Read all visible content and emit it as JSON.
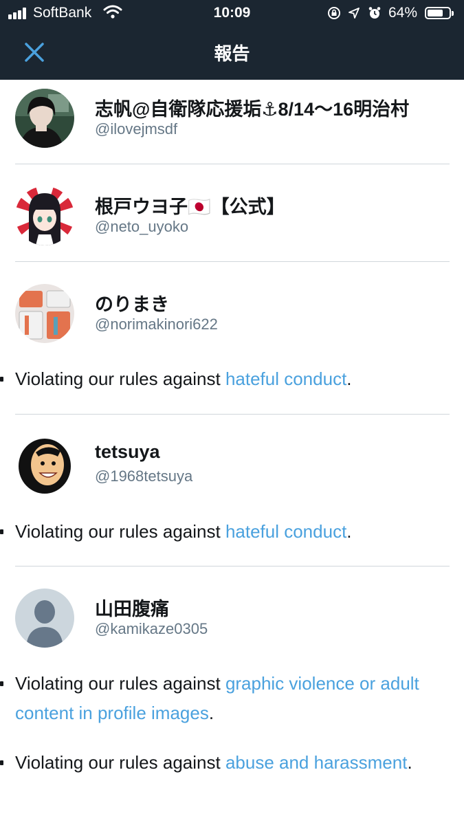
{
  "status_bar": {
    "carrier": "SoftBank",
    "time": "10:09",
    "battery": "64%",
    "battery_level": 0.64
  },
  "nav": {
    "title": "報告",
    "close_icon": "close-icon",
    "accent_color": "#4aa1de",
    "bar_color": "#1b2631"
  },
  "accounts": [
    {
      "name": "志帆@自衛隊応援垢⚓8/14〜16明治村",
      "handle": "@ilovejmsdf"
    },
    {
      "name": "根戸ウヨ子🇯🇵【公式】",
      "handle": "@neto_uyoko"
    },
    {
      "name": "のりまき",
      "handle": "@norimakinori622",
      "reasons": [
        {
          "prefix": "Violating our rules against ",
          "link": "hateful conduct",
          "suffix": "."
        }
      ]
    },
    {
      "name": "tetsuya",
      "handle": "@1968tetsuya",
      "reasons": [
        {
          "prefix": "Violating our rules against ",
          "link": "hateful conduct",
          "suffix": "."
        }
      ]
    },
    {
      "name": "山田腹痛",
      "handle": "@kamikaze0305",
      "reasons": [
        {
          "prefix": "Violating our rules against ",
          "link": "graphic violence or adult content in profile images",
          "suffix": "."
        },
        {
          "prefix": "Violating our rules against ",
          "link": "abuse and harassment",
          "suffix": "."
        }
      ]
    }
  ]
}
